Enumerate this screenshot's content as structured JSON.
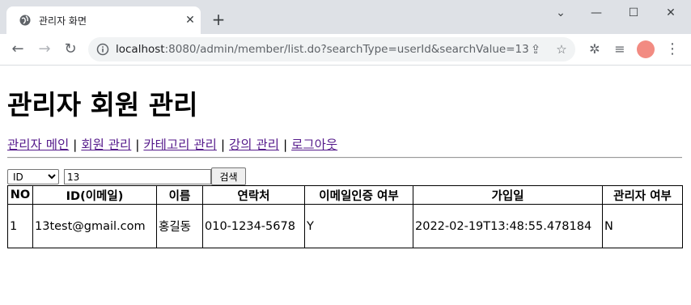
{
  "browser": {
    "tab_title": "관리자 화면",
    "url_host": "localhost",
    "url_rest": ":8080/admin/member/list.do?searchType=userId&searchValue=13"
  },
  "page": {
    "heading": "관리자 회원 관리",
    "nav": [
      {
        "label": "관리자 메인"
      },
      {
        "label": "회원 관리"
      },
      {
        "label": "카테고리 관리"
      },
      {
        "label": "강의 관리"
      },
      {
        "label": "로그아웃"
      }
    ],
    "nav_separator": "|",
    "search": {
      "type_selected": "ID",
      "value": "13",
      "button_label": "검색"
    },
    "table": {
      "headers": [
        "NO",
        "ID(이메일)",
        "이름",
        "연락처",
        "이메일인증 여부",
        "가입일",
        "관리자 여부"
      ],
      "rows": [
        [
          "1",
          "13test@gmail.com",
          "홍길동",
          "010-1234-5678",
          "Y",
          "2022-02-19T13:48:55.478184",
          "N"
        ]
      ]
    }
  }
}
